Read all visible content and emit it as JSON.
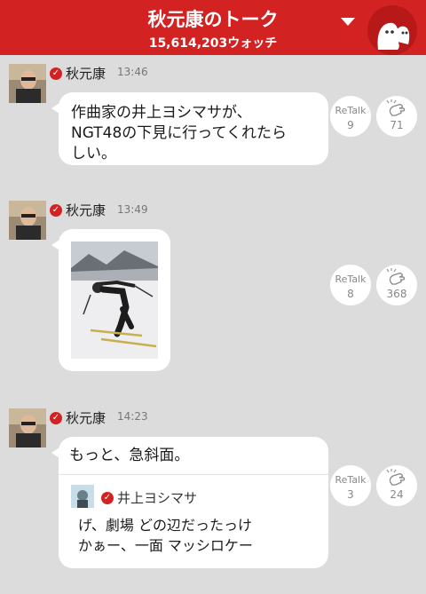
{
  "header": {
    "title": "秋元康のトーク",
    "watch_count": "15,614,203ウォッチ",
    "dropdown_icon": "caret-down-icon",
    "mascot_icon": "ghost-mascot-icon"
  },
  "theme": {
    "accent": "#d32222",
    "background": "#dcdcdc"
  },
  "messages": [
    {
      "sender": "秋元康",
      "time": "13:46",
      "type": "text",
      "lines": [
        "作曲家の井上ヨシマサが、",
        "NGT48の下見に行ってくれたら",
        "しい。"
      ],
      "retalk_label": "ReTalk",
      "retalk_count": "9",
      "claps": "71"
    },
    {
      "sender": "秋元康",
      "time": "13:49",
      "type": "image",
      "image": "ski-photo",
      "retalk_label": "ReTalk",
      "retalk_count": "8",
      "claps": "368"
    },
    {
      "sender": "秋元康",
      "time": "14:23",
      "type": "text-quote",
      "lines": [
        "もっと、急斜面。"
      ],
      "quote": {
        "name": "井上ヨシマサ",
        "lines": [
          "げ、劇場 どの辺だったっけ",
          "かぁー、一面 マッシロケー"
        ]
      },
      "retalk_label": "ReTalk",
      "retalk_count": "3",
      "claps": "24"
    }
  ]
}
